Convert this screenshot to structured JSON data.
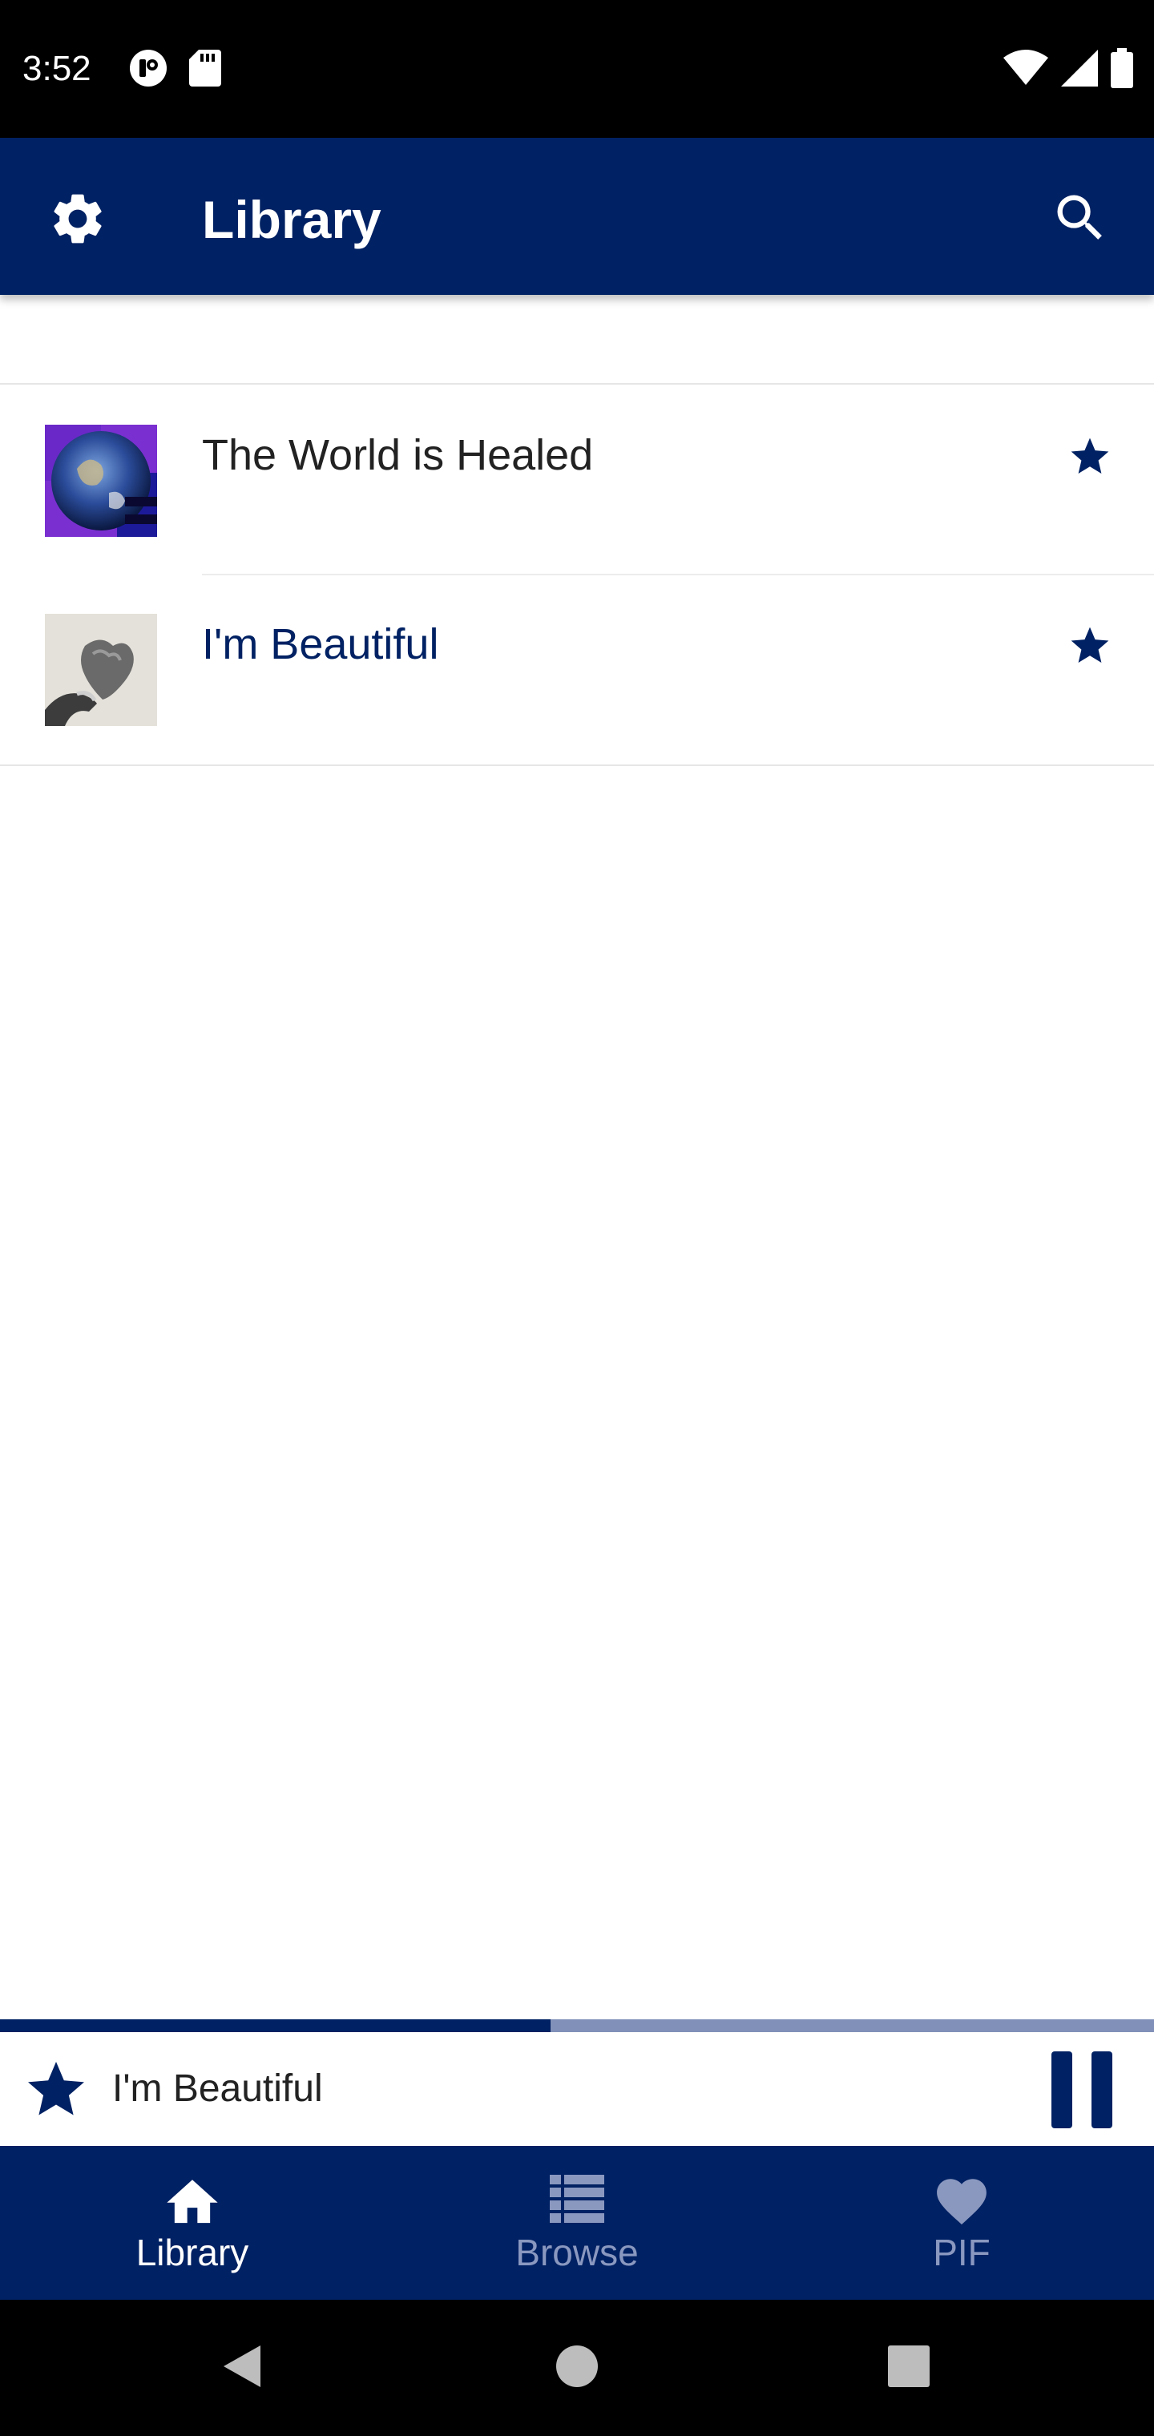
{
  "status_bar": {
    "time": "3:52",
    "left_icons": [
      "privacy-indicator-icon",
      "sd-card-icon"
    ],
    "right_icons": [
      "wifi-icon",
      "cell-signal-icon",
      "battery-icon"
    ]
  },
  "app_bar": {
    "title": "Library",
    "left_icon": "gear-icon",
    "right_icon": "search-icon"
  },
  "library": {
    "items": [
      {
        "title": "The World is Healed",
        "favorite": true,
        "playing": false
      },
      {
        "title": "I'm Beautiful",
        "favorite": true,
        "playing": true
      }
    ]
  },
  "player": {
    "progress_fraction": 0.477,
    "now_playing_title": "I'm Beautiful",
    "favorite": true,
    "state": "playing",
    "control_icon": "pause-icon"
  },
  "bottom_nav": {
    "items": [
      {
        "label": "Library",
        "icon": "home-icon",
        "active": true
      },
      {
        "label": "Browse",
        "icon": "list-icon",
        "active": false
      },
      {
        "label": "PIF",
        "icon": "heart-icon",
        "active": false
      }
    ]
  },
  "colors": {
    "primary": "#002163",
    "progress_track": "#8090b8",
    "inactive_nav": "#8a98c0",
    "text": "#222222"
  }
}
